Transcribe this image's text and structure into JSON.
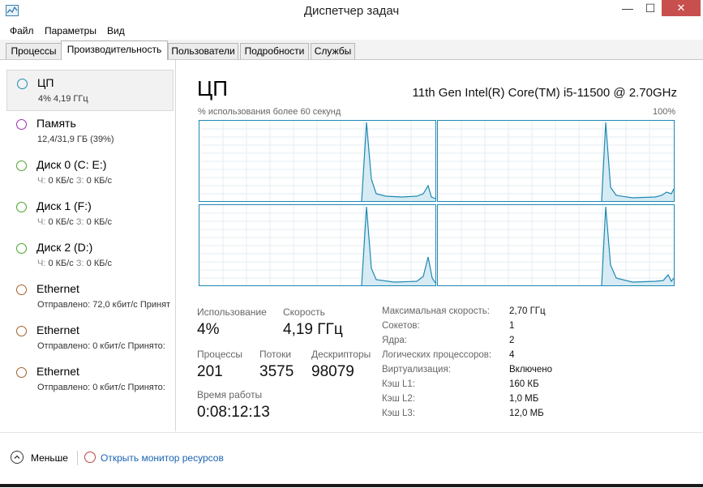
{
  "window": {
    "title": "Диспетчер задач",
    "close_glyph": "✕",
    "max_glyph": "☐",
    "min_glyph": "—"
  },
  "menu": [
    "Файл",
    "Параметры",
    "Вид"
  ],
  "tabs": [
    "Процессы",
    "Производительность",
    "Пользователи",
    "Подробности",
    "Службы"
  ],
  "sidebar": [
    {
      "title": "ЦП",
      "sub": "4% 4,19 ГГц",
      "color": "#1f88b2"
    },
    {
      "title": "Память",
      "sub": "12,4/31,9 ГБ (39%)",
      "color": "#9b2fae"
    },
    {
      "title": "Диск 0 (C: E:)",
      "sub_a": "Ч:",
      "sub_b": "0 КБ/с",
      "sub_c": "З:",
      "sub_d": "0 КБ/с",
      "color": "#4ca22a"
    },
    {
      "title": "Диск 1 (F:)",
      "sub_a": "Ч:",
      "sub_b": "0 КБ/с",
      "sub_c": "З:",
      "sub_d": "0 КБ/с",
      "color": "#4ca22a"
    },
    {
      "title": "Диск 2 (D:)",
      "sub_a": "Ч:",
      "sub_b": "0 КБ/с",
      "sub_c": "З:",
      "sub_d": "0 КБ/с",
      "color": "#4ca22a"
    },
    {
      "title": "Ethernet",
      "sub": "Отправлено: 72,0 кбит/с  Принят",
      "color": "#a4602a"
    },
    {
      "title": "Ethernet",
      "sub": "Отправлено: 0 кбит/с  Принято:",
      "color": "#a4602a"
    },
    {
      "title": "Ethernet",
      "sub": "Отправлено: 0 кбит/с  Принято:",
      "color": "#a4602a"
    }
  ],
  "main": {
    "title": "ЦП",
    "cpu_model": "11th Gen Intel(R) Core(TM) i5-11500 @ 2.70GHz",
    "graph_caption": "% использования более 60 секунд",
    "graph_max": "100%",
    "stats": {
      "usage_label": "Использование",
      "usage_value": "4%",
      "speed_label": "Скорость",
      "speed_value": "4,19 ГГц",
      "processes_label": "Процессы",
      "processes_value": "201",
      "threads_label": "Потоки",
      "threads_value": "3575",
      "handles_label": "Дескрипторы",
      "handles_value": "98079",
      "uptime_label": "Время работы",
      "uptime_value": "0:08:12:13"
    },
    "properties": [
      {
        "label": "Максимальная скорость:",
        "value": "2,70 ГГц"
      },
      {
        "label": "Сокетов:",
        "value": "1"
      },
      {
        "label": "Ядра:",
        "value": "2"
      },
      {
        "label": "Логических процессоров:",
        "value": "4"
      },
      {
        "label": "Виртуализация:",
        "value": "Включено"
      },
      {
        "label": "Кэш L1:",
        "value": "160 КБ"
      },
      {
        "label": "Кэш L2:",
        "value": "1,0 МБ"
      },
      {
        "label": "Кэш L3:",
        "value": "12,0 МБ"
      }
    ]
  },
  "footer": {
    "less": "Меньше",
    "monitor_link": "Открыть монитор ресурсов"
  },
  "colors": {
    "accent": "#1f88b2",
    "graph_fill": "#d6ebf4",
    "grid": "#e3eef3"
  }
}
